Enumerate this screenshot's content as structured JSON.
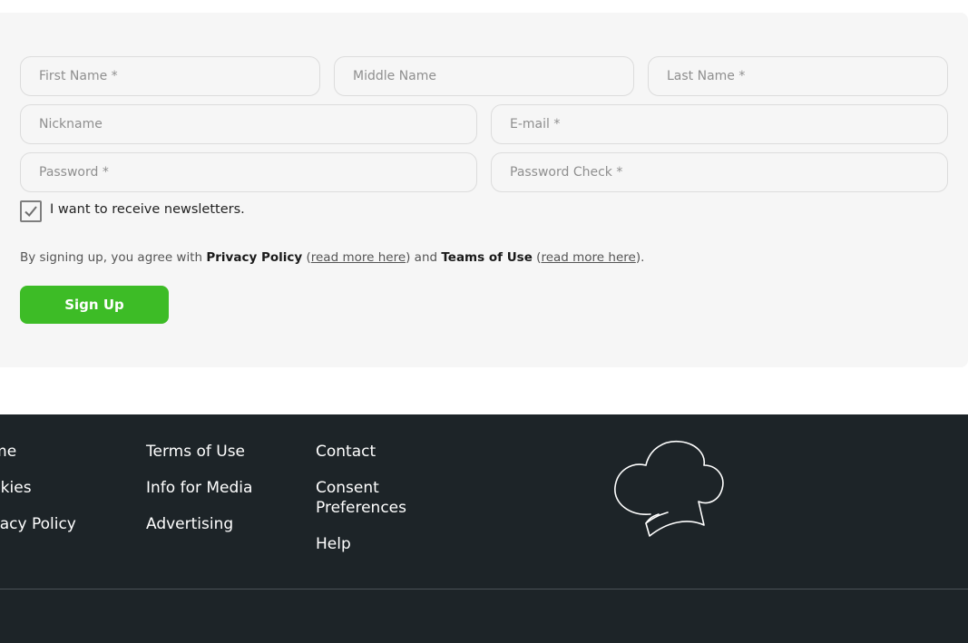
{
  "form": {
    "first_name_placeholder": "First Name *",
    "middle_name_placeholder": "Middle Name",
    "last_name_placeholder": "Last Name *",
    "nickname_placeholder": "Nickname",
    "email_placeholder": "E-mail *",
    "password_placeholder": "Password *",
    "password_check_placeholder": "Password Check *",
    "newsletter_label": "I want to receive newsletters.",
    "newsletter_checked": true,
    "terms": {
      "prefix": "By signing up, you agree with ",
      "privacy_policy": "Privacy Policy",
      "open_paren_1": " (",
      "read_more_1": "read more here",
      "close_and": ") and ",
      "terms_of_use": "Teams of Use",
      "open_paren_2": " (",
      "read_more_2": "read more here",
      "close_end": ")."
    },
    "signup_label": "Sign Up"
  },
  "footer": {
    "col1": [
      "Home",
      "Cookies",
      "Privacy Policy"
    ],
    "col2": [
      "Terms of Use",
      "Info for Media",
      "Advertising"
    ],
    "col3": [
      "Contact",
      "Consent Preferences",
      "Help"
    ],
    "logo_icon": "chef-hat-icon"
  },
  "colors": {
    "accent_green": "#3dbc26",
    "footer_bg": "#1d2428",
    "form_bg": "#f6f6f6"
  }
}
